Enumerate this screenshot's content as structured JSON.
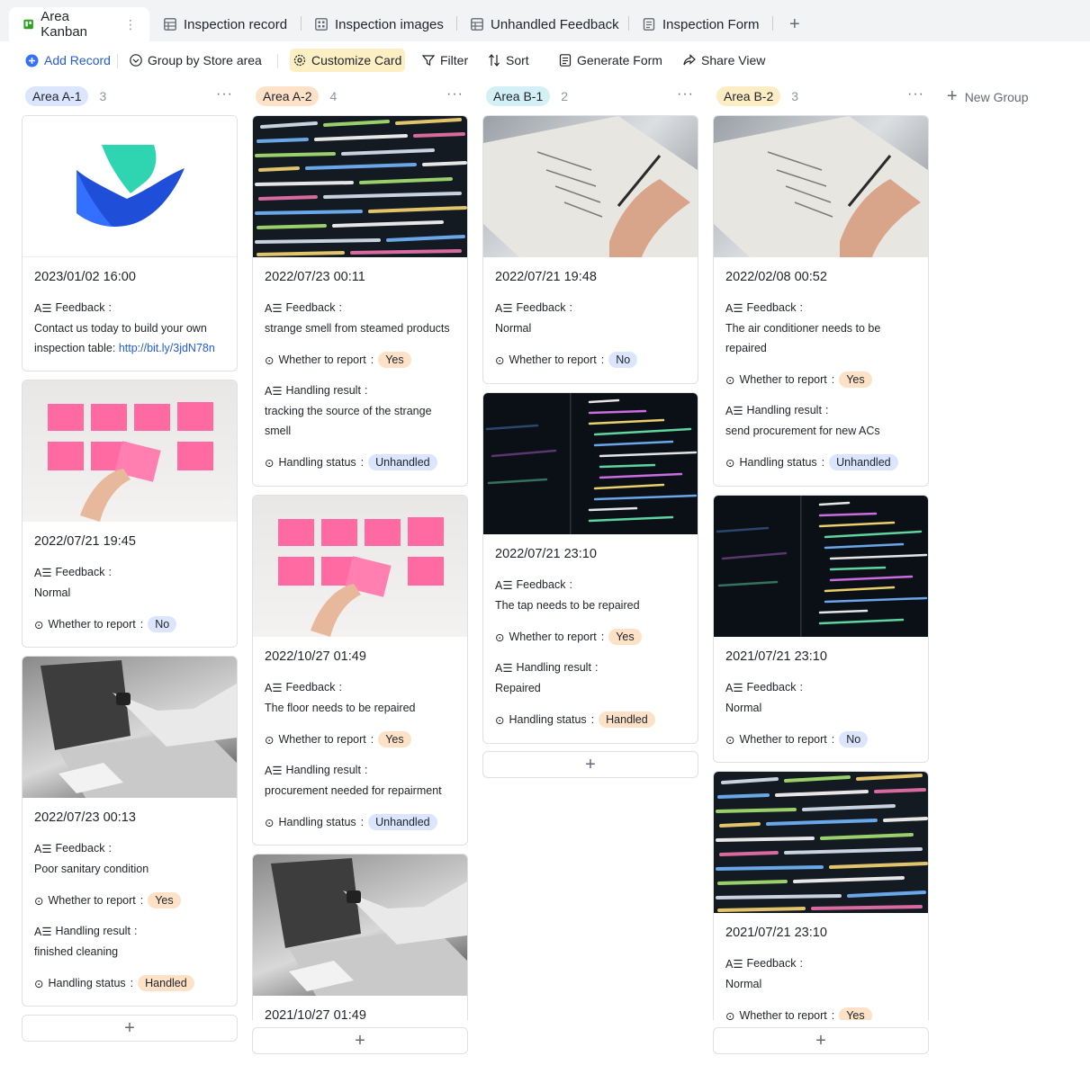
{
  "tabs": [
    {
      "label": "Area Kanban",
      "icon": "kanban-icon"
    },
    {
      "label": "Inspection record",
      "icon": "grid-icon"
    },
    {
      "label": "Inspection images",
      "icon": "gallery-icon"
    },
    {
      "label": "Unhandled Feedback",
      "icon": "grid-icon"
    },
    {
      "label": "Inspection Form",
      "icon": "form-icon"
    }
  ],
  "toolbar": {
    "add_record": "Add Record",
    "group_by": "Group by Store area",
    "customize_card": "Customize Card",
    "filter": "Filter",
    "sort": "Sort",
    "generate_form": "Generate Form",
    "share_view": "Share View"
  },
  "new_group": "New Group",
  "field_labels": {
    "feedback": "Feedback",
    "report": "Whether to report",
    "result": "Handling result",
    "status": "Handling status"
  },
  "colors": {
    "accent": "#245bdb",
    "highlight": "#fcefc4",
    "yes_badge": "#fde2c8",
    "no_badge": "#dbe6fe"
  },
  "groups": [
    {
      "name": "Area A-1",
      "count": "3",
      "tag_color": "#dbe6fe",
      "cards": [
        {
          "image": "logo",
          "date": "2023/01/02  16:00",
          "feedback": "Contact us today to build your own inspection table: ",
          "link": "http://bit.ly/3jdN78n"
        },
        {
          "image": "sticky-notes",
          "date": "2022/07/21  19:45",
          "feedback": "Normal",
          "report": "No"
        },
        {
          "image": "laptop",
          "date": "2022/07/23  00:13",
          "feedback": "Poor sanitary condition",
          "report": "Yes",
          "result": "finished cleaning",
          "status": "Handled"
        }
      ]
    },
    {
      "name": "Area A-2",
      "count": "4",
      "tag_color": "#fde2c8",
      "cards": [
        {
          "image": "code-dark",
          "date": "2022/07/23  00:11",
          "feedback": "strange smell from steamed products",
          "report": "Yes",
          "result": "tracking the source of the strange smell",
          "status": "Unhandled"
        },
        {
          "image": "sticky-notes",
          "date": "2022/10/27  01:49",
          "feedback": "The floor needs to be repaired",
          "report": "Yes",
          "result": "procurement needed for repairment",
          "status": "Unhandled"
        },
        {
          "image": "laptop",
          "date": "2021/10/27  01:49"
        }
      ]
    },
    {
      "name": "Area B-1",
      "count": "2",
      "tag_color": "#d4f0f7",
      "cards": [
        {
          "image": "checklist",
          "date": "2022/07/21  19:48",
          "feedback": "Normal",
          "report": "No"
        },
        {
          "image": "code-screen",
          "date": "2022/07/21  23:10",
          "feedback": "The tap needs to be repaired",
          "report": "Yes",
          "result": "Repaired",
          "status": "Handled"
        }
      ]
    },
    {
      "name": "Area B-2",
      "count": "3",
      "tag_color": "#fdedc4",
      "cards": [
        {
          "image": "checklist",
          "date": "2022/02/08  00:52",
          "feedback": "The air conditioner needs to be repaired",
          "report": "Yes",
          "result": "send procurement for new ACs",
          "status": "Unhandled"
        },
        {
          "image": "code-screen",
          "date": "2021/07/21  23:10",
          "feedback": "Normal",
          "report": "No"
        },
        {
          "image": "code-dark",
          "date": "2021/07/21  23:10",
          "feedback": "Normal",
          "report": "Yes"
        }
      ]
    }
  ]
}
